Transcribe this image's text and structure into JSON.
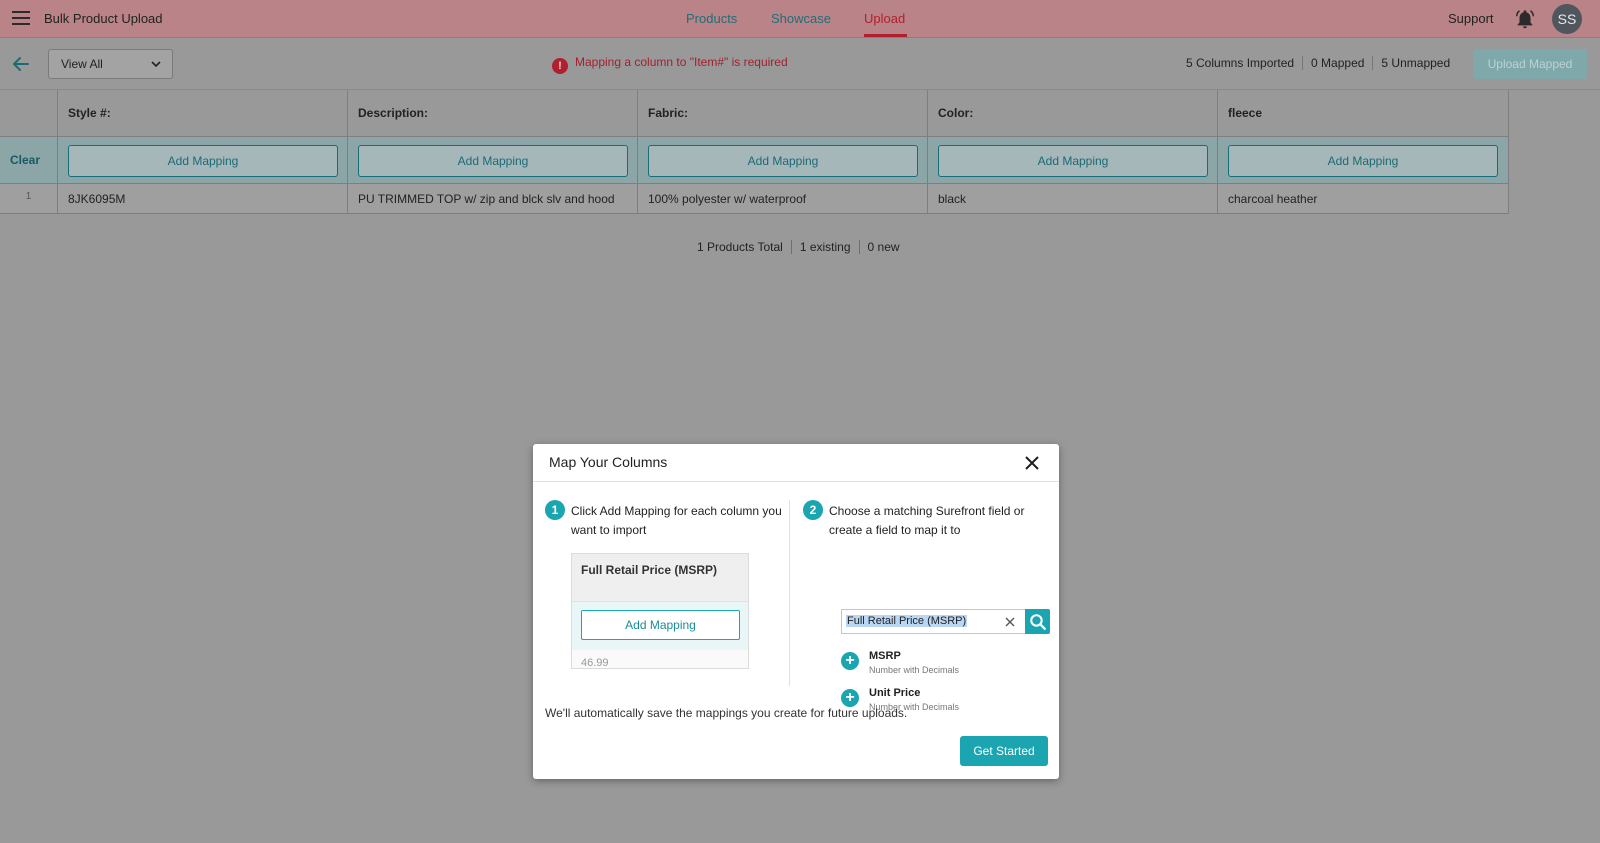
{
  "header": {
    "app_title": "Bulk Product Upload",
    "tabs": [
      {
        "label": "Products",
        "active": false
      },
      {
        "label": "Showcase",
        "active": false
      },
      {
        "label": "Upload",
        "active": true
      }
    ],
    "support_label": "Support",
    "avatar_initials": "SS"
  },
  "toolbar": {
    "view_select_value": "View All",
    "error_message": "Mapping a column to \"Item#\" is required",
    "stats": [
      "5 Columns Imported",
      "0 Mapped",
      "5 Unmapped"
    ],
    "upload_button": "Upload Mapped"
  },
  "table": {
    "clear_label": "Clear",
    "columns": [
      "Style #:",
      "Description:",
      "Fabric:",
      "Color:",
      "fleece"
    ],
    "add_mapping_label": "Add Mapping",
    "rows": [
      {
        "num": "1",
        "cells": [
          "8JK6095M",
          "PU TRIMMED TOP w/ zip and blck slv and hood",
          "100% polyester w/ waterproof",
          "black",
          "charcoal heather"
        ]
      }
    ]
  },
  "totals": [
    "1 Products Total",
    "1 existing",
    "0 new"
  ],
  "modal": {
    "title": "Map Your Columns",
    "step1": {
      "num": "1",
      "text": "Click Add Mapping for each column you want to import"
    },
    "example": {
      "header": "Full Retail Price (MSRP)",
      "button": "Add Mapping",
      "value": "46.99"
    },
    "step2": {
      "num": "2",
      "text": "Choose a matching Surefront field or create a field to map it to"
    },
    "search_value": "Full Retail Price (MSRP)",
    "options": [
      {
        "name": "MSRP",
        "type": "Number with Decimals"
      },
      {
        "name": "Unit Price",
        "type": "Number with Decimals"
      }
    ],
    "footnote": "We'll automatically save the mappings you create for future uploads.",
    "get_started": "Get Started"
  },
  "colors": {
    "accent": "#1aa5b0",
    "error": "#b1202e",
    "header_bg": "#b98387"
  }
}
